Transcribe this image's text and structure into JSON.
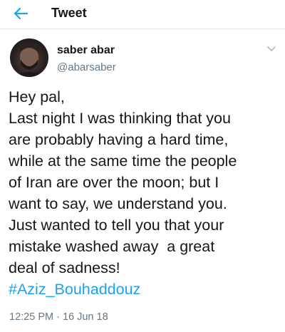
{
  "header": {
    "title": "Tweet",
    "back_icon": "back-arrow-icon"
  },
  "author": {
    "display_name": "saber abar",
    "handle": "@abarsaber",
    "menu_icon": "chevron-down-icon"
  },
  "tweet": {
    "lines": [
      "Hey pal,",
      "Last night I was thinking that you",
      "are probably having a hard time,",
      "while at the same time the people",
      "of Iran are over the moon; but I",
      "want to say, we understand you.",
      "Just wanted to tell you that your",
      "mistake washed away  a great",
      "deal of sadness!"
    ],
    "hashtag": "#Aziz_Bouhaddouz",
    "timestamp": "12:25 PM · 16 Jun 18"
  },
  "colors": {
    "accent": "#1da1f2",
    "text": "#14171a",
    "secondary": "#657786"
  }
}
